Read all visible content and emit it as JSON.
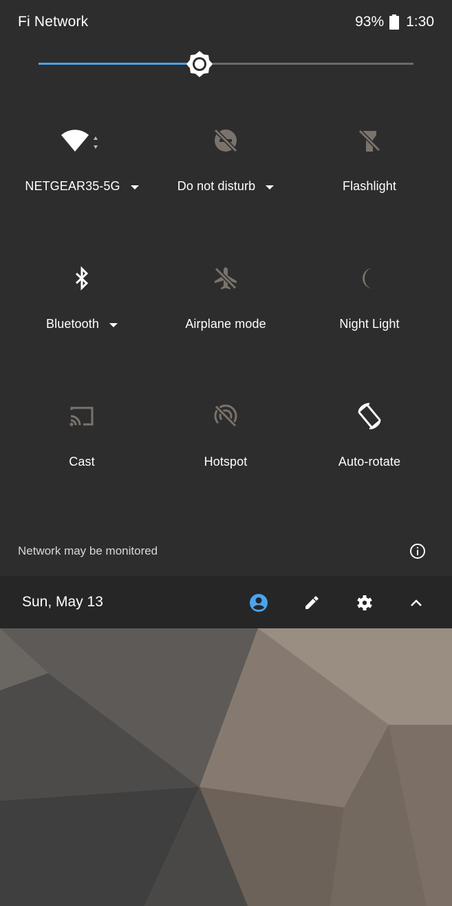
{
  "status_bar": {
    "carrier": "Fi Network",
    "battery": "93%",
    "time": "1:30"
  },
  "brightness": {
    "level_fraction": 0.43
  },
  "tiles": [
    {
      "label": "NETGEAR35-5G",
      "icon": "wifi-icon"
    },
    {
      "label": "Do not disturb",
      "icon": "do-not-disturb-icon"
    },
    {
      "label": "Flashlight",
      "icon": "flashlight-icon"
    },
    {
      "label": "Bluetooth",
      "icon": "bluetooth-icon"
    },
    {
      "label": "Airplane mode",
      "icon": "airplane-off-icon"
    },
    {
      "label": "Night Light",
      "icon": "moon-icon"
    },
    {
      "label": "Cast",
      "icon": "cast-icon"
    },
    {
      "label": "Hotspot",
      "icon": "hotspot-off-icon"
    },
    {
      "label": "Auto-rotate",
      "icon": "auto-rotate-icon"
    }
  ],
  "footer": {
    "message": "Network may be monitored"
  },
  "bottom_bar": {
    "date": "Sun, May 13"
  },
  "colors": {
    "shade_background": "#2d2d2d",
    "accent": "#4aa4ee",
    "disabled_icon": "#7a736c"
  }
}
